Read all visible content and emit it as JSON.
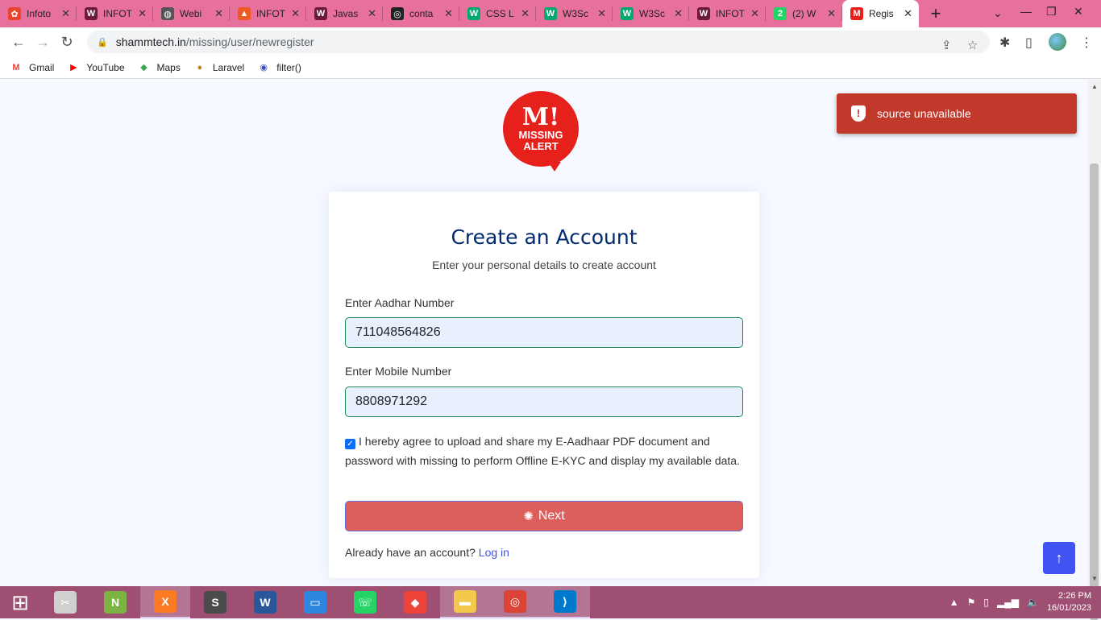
{
  "tabs": [
    {
      "title": "Infoto",
      "favicon_color": "#e8442e",
      "favicon_glyph": "✿"
    },
    {
      "title": "INFOT",
      "favicon_color": "#6a1b3a",
      "favicon_glyph": "W"
    },
    {
      "title": "Webi",
      "favicon_color": "#555555",
      "favicon_glyph": "◍"
    },
    {
      "title": "INFOT",
      "favicon_color": "#ee5a24",
      "favicon_glyph": "▲"
    },
    {
      "title": "Javas",
      "favicon_color": "#6a1b3a",
      "favicon_glyph": "W"
    },
    {
      "title": "conta",
      "favicon_color": "#222222",
      "favicon_glyph": "◎"
    },
    {
      "title": "CSS L",
      "favicon_color": "#04aa6d",
      "favicon_glyph": "W"
    },
    {
      "title": "W3Sc",
      "favicon_color": "#04aa6d",
      "favicon_glyph": "W"
    },
    {
      "title": "W3Sc",
      "favicon_color": "#04aa6d",
      "favicon_glyph": "W"
    },
    {
      "title": "INFOT",
      "favicon_color": "#6a1b3a",
      "favicon_glyph": "W"
    },
    {
      "title": "(2) W",
      "favicon_color": "#25d366",
      "favicon_glyph": "2"
    },
    {
      "title": "Regis",
      "favicon_color": "#e6211c",
      "favicon_glyph": "M",
      "active": true
    }
  ],
  "address": {
    "domain": "shammtech.in",
    "path": "/missing/user/newregister"
  },
  "bookmarks": [
    {
      "label": "Gmail",
      "icon": "gmail-icon",
      "color": "#ea4335",
      "glyph": "M"
    },
    {
      "label": "YouTube",
      "icon": "youtube-icon",
      "color": "#ff0000",
      "glyph": "▶"
    },
    {
      "label": "Maps",
      "icon": "maps-icon",
      "color": "#34a853",
      "glyph": "◆"
    },
    {
      "label": "Laravel",
      "icon": "laravel-icon",
      "color": "#c5831c",
      "glyph": "●"
    },
    {
      "label": "filter()",
      "icon": "globe-icon",
      "color": "#3b4cc0",
      "glyph": "◉"
    }
  ],
  "logo": {
    "letter": "M!",
    "line1": "MISSING",
    "line2": "ALERT"
  },
  "form": {
    "title": "Create an Account",
    "subtitle": "Enter your personal details to create account",
    "aadhar_label": "Enter Aadhar Number",
    "aadhar_value": "711048564826",
    "mobile_label": "Enter Mobile Number",
    "mobile_value": "8808971292",
    "agree_checked": true,
    "agree_text": "I hereby agree to upload and share my E-Aadhaar PDF document and password with missing to perform Offline E-KYC and display my available data.",
    "next_label": "Next",
    "login_prompt": "Already have an account?",
    "login_link": "Log in"
  },
  "toast": {
    "message": "source unavailable",
    "color": "#c0392b"
  },
  "taskbar": {
    "apps": [
      {
        "name": "start",
        "glyph": "⊞",
        "color": "transparent"
      },
      {
        "name": "snipping-tool",
        "glyph": "✂",
        "color": "#d0d0d0"
      },
      {
        "name": "notepad-plus-plus",
        "glyph": "N",
        "color": "#7cb342"
      },
      {
        "name": "xampp",
        "glyph": "X",
        "color": "#fb7a24",
        "active": true
      },
      {
        "name": "sublime-text",
        "glyph": "S",
        "color": "#4b4b4b"
      },
      {
        "name": "word",
        "glyph": "W",
        "color": "#2b579a"
      },
      {
        "name": "remote-desktop",
        "glyph": "▭",
        "color": "#2e86de"
      },
      {
        "name": "whatsapp",
        "glyph": "☏",
        "color": "#25d366"
      },
      {
        "name": "anydesk",
        "glyph": "◆",
        "color": "#ef443b"
      },
      {
        "name": "file-explorer",
        "glyph": "▬",
        "color": "#f2c94c",
        "active": true
      },
      {
        "name": "chrome",
        "glyph": "◎",
        "color": "#db4437",
        "active": true
      },
      {
        "name": "vscode",
        "glyph": "⟩",
        "color": "#007acc",
        "active": true
      }
    ],
    "time": "2:26 PM",
    "date": "16/01/2023"
  }
}
